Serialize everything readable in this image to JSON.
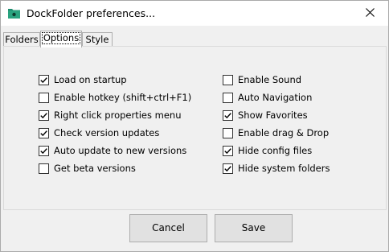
{
  "window": {
    "title": "DockFolder preferences...",
    "icon": "folder-app-icon",
    "close_icon": "close-icon"
  },
  "tabs": [
    {
      "label": "Folders",
      "selected": false
    },
    {
      "label": "Options",
      "selected": true
    },
    {
      "label": "Style",
      "selected": false
    }
  ],
  "options": {
    "left": [
      {
        "label": "Load on startup",
        "checked": true
      },
      {
        "label": "Enable hotkey (shift+ctrl+F1)",
        "checked": false
      },
      {
        "label": "Right click properties menu",
        "checked": true
      },
      {
        "label": "Check version updates",
        "checked": true
      },
      {
        "label": "Auto update to new versions",
        "checked": true
      },
      {
        "label": "Get beta versions",
        "checked": false
      }
    ],
    "right": [
      {
        "label": "Enable Sound",
        "checked": false
      },
      {
        "label": "Auto Navigation",
        "checked": false
      },
      {
        "label": "Show Favorites",
        "checked": true
      },
      {
        "label": "Enable drag & Drop",
        "checked": false
      },
      {
        "label": "Hide config files",
        "checked": true
      },
      {
        "label": "Hide system folders",
        "checked": true
      }
    ]
  },
  "buttons": {
    "cancel": "Cancel",
    "save": "Save"
  },
  "colors": {
    "icon_green": "#1e8c6e"
  }
}
